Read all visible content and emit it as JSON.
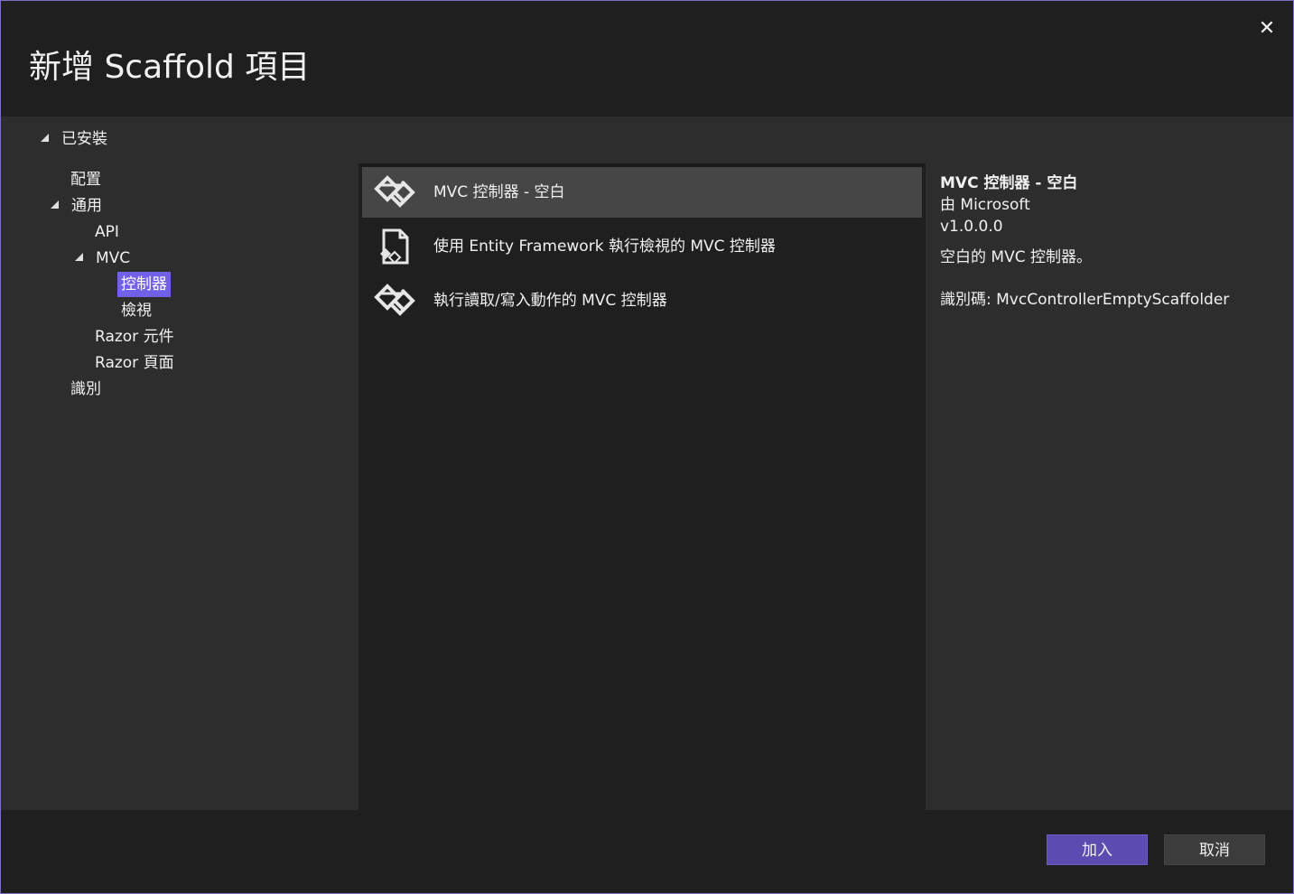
{
  "dialog": {
    "title": "新增 Scaffold 項目",
    "close_glyph": "✕"
  },
  "tree": {
    "installed": "已安裝",
    "items": [
      {
        "label": "配置"
      },
      {
        "label": "通用"
      },
      {
        "label": "API"
      },
      {
        "label": "MVC"
      },
      {
        "label": "控制器",
        "selected": true
      },
      {
        "label": "檢視"
      },
      {
        "label": "Razor 元件"
      },
      {
        "label": "Razor 頁面"
      },
      {
        "label": "識別"
      }
    ]
  },
  "templates": [
    {
      "label": "MVC 控制器 - 空白",
      "icon": "mvc-controller-icon",
      "selected": true
    },
    {
      "label": "使用 Entity Framework 執行檢視的 MVC 控制器",
      "icon": "entity-framework-icon"
    },
    {
      "label": "執行讀取/寫入動作的 MVC 控制器",
      "icon": "mvc-controller-icon"
    }
  ],
  "details": {
    "name": "MVC 控制器 - 空白",
    "by": "由 Microsoft",
    "version": "v1.0.0.0",
    "description": "空白的 MVC 控制器。",
    "id": "識別碼: MvcControllerEmptyScaffolder"
  },
  "footer": {
    "add_label": "加入",
    "cancel_label": "取消"
  },
  "colors": {
    "accent": "#7160e8",
    "primary_button": "#5c4bb0",
    "border": "#7f6fc8"
  }
}
